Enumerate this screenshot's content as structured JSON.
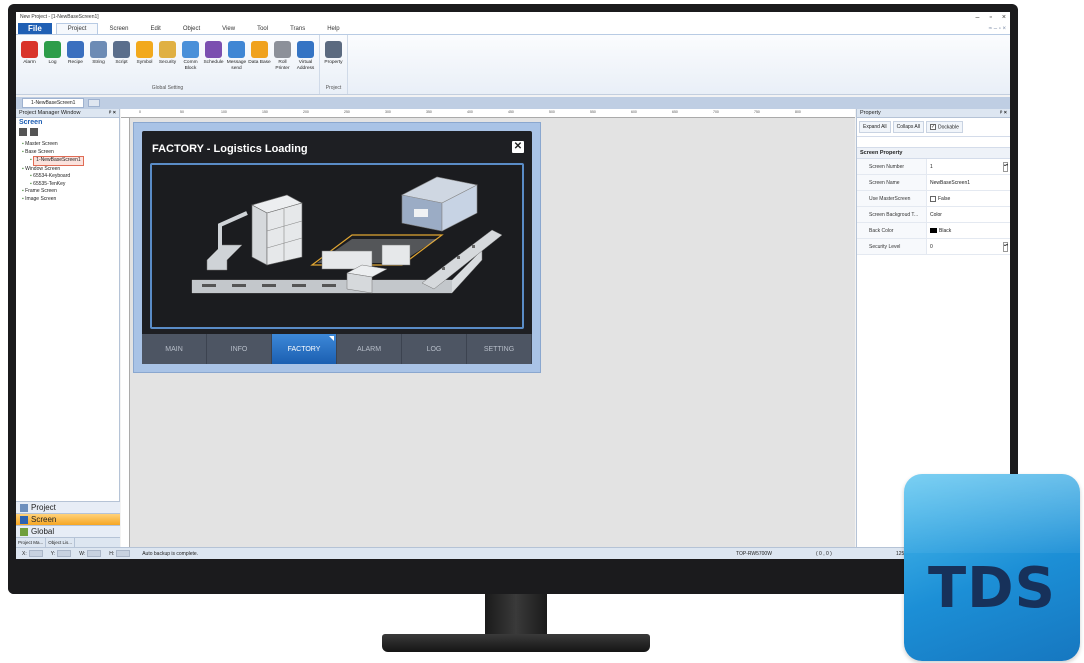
{
  "window": {
    "title": "New Project - [1-NewBaseScreen1]",
    "controls": [
      "–",
      "▫",
      "×"
    ],
    "ribbon_right": "≈ – ▫ ×"
  },
  "ribbon_tabs": [
    "File",
    "Project",
    "Screen",
    "Edit",
    "Object",
    "View",
    "Tool",
    "Trans",
    "Help"
  ],
  "ribbon_groups": [
    {
      "label": "Global Setting",
      "items": [
        {
          "label": "Alarm",
          "color": "#d9342b"
        },
        {
          "label": "Log",
          "color": "#2d9d4a"
        },
        {
          "label": "Recipe",
          "color": "#3a6fbf"
        },
        {
          "label": "String",
          "color": "#6c8bb5"
        },
        {
          "label": "Script",
          "color": "#5a6e8c"
        },
        {
          "label": "Symbol",
          "color": "#f2a91c"
        },
        {
          "label": "Security",
          "color": "#e0b042"
        },
        {
          "label": "Comm Block",
          "color": "#4a90d9"
        },
        {
          "label": "Schedule",
          "color": "#7b4fb0"
        },
        {
          "label": "Message send",
          "color": "#3f86d4"
        },
        {
          "label": "Data Base",
          "color": "#f0a21e"
        },
        {
          "label": "Roll Printer",
          "color": "#8c9099"
        },
        {
          "label": "Virtual Address",
          "color": "#3574c4"
        }
      ]
    },
    {
      "label": "Project",
      "items": [
        {
          "label": "Property",
          "color": "#5b6a80"
        }
      ]
    }
  ],
  "doc_tab": "1-NewBaseScreen1",
  "left_panel": {
    "title": "Project Manager Window",
    "heading": "Screen",
    "tree": [
      {
        "label": "Master Screen",
        "indent": 1
      },
      {
        "label": "Base Screen",
        "indent": 1
      },
      {
        "label": "1-NewBaseScreen1",
        "indent": 3,
        "selected": true
      },
      {
        "label": "Window Screen",
        "indent": 1
      },
      {
        "label": "65534-Keyboard",
        "indent": 3
      },
      {
        "label": "65535-TenKey",
        "indent": 3
      },
      {
        "label": "Frame Screen",
        "indent": 1
      },
      {
        "label": "Image Screen",
        "indent": 1
      }
    ],
    "nav": [
      {
        "label": "Project",
        "active": false
      },
      {
        "label": "Screen",
        "active": true
      },
      {
        "label": "Global",
        "active": false
      }
    ],
    "bottom_tabs": [
      "Project Ma...",
      "Object Lis..."
    ]
  },
  "hmi": {
    "title": "FACTORY - Logistics Loading",
    "close_glyph": "✕",
    "nav": [
      {
        "label": "MAIN",
        "active": false
      },
      {
        "label": "INFO",
        "active": false
      },
      {
        "label": "FACTORY",
        "active": true
      },
      {
        "label": "ALARM",
        "active": false
      },
      {
        "label": "LOG",
        "active": false
      },
      {
        "label": "SETTING",
        "active": false
      }
    ]
  },
  "ruler_labels": [
    "0",
    "50",
    "100",
    "150",
    "200",
    "250",
    "300",
    "350",
    "400",
    "450",
    "500",
    "550",
    "600",
    "650",
    "700",
    "750",
    "800"
  ],
  "right_panel": {
    "title": "Property",
    "expand_all": "Expand All",
    "collapse_all": "Collaps All",
    "dockable_label": "Dockable",
    "dockable_checked": true,
    "section": "Screen Property",
    "rows": [
      {
        "key": "Screen Number",
        "value": "1",
        "spin": true
      },
      {
        "key": "Screen Name",
        "value": "NewBaseScreen1"
      },
      {
        "key": "Use MasterScreen",
        "value": "False",
        "checkbox": true
      },
      {
        "key": "Screen Backgroud T...",
        "value": "Color"
      },
      {
        "key": "Back Color",
        "value": "Black",
        "swatch": "#000000"
      },
      {
        "key": "Security Level",
        "value": "0",
        "spin": true
      }
    ]
  },
  "status": {
    "x_label": "X:",
    "y_label": "Y:",
    "w_label": "W:",
    "h_label": "H:",
    "message": "Auto backup is complete.",
    "model": "TOP-RW5700W",
    "coords": "( 0 , 0 )",
    "zoom": "125"
  },
  "brand": {
    "badge_text": "TDS",
    "badge_color": "#2a9ee0"
  }
}
